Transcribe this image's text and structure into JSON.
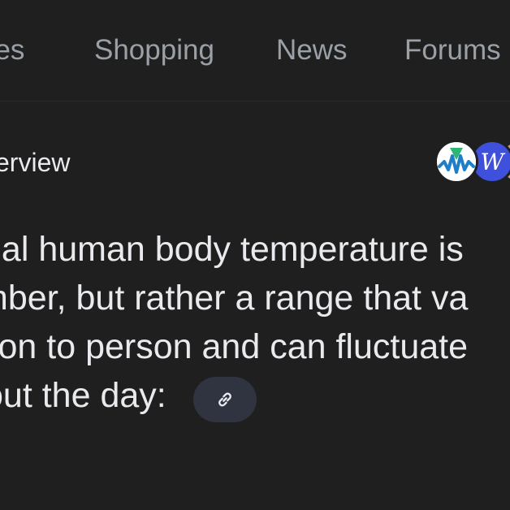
{
  "nav": {
    "tabs": [
      {
        "label": "ges"
      },
      {
        "label": "Shopping"
      },
      {
        "label": "News"
      },
      {
        "label": "Forums"
      }
    ]
  },
  "overview": {
    "title": "erview",
    "sources": [
      {
        "icon": "m-logo-icon"
      },
      {
        "icon": "w-logo-icon"
      },
      {
        "icon": "third-source-icon"
      }
    ]
  },
  "content": {
    "lines": [
      "nal human body temperature is",
      "mber, but rather a range that va",
      "son to person and can fluctuate",
      "out the day:"
    ],
    "link_icon": "link-icon"
  },
  "colors": {
    "background": "#1f1f1f",
    "text": "#e8eaed",
    "muted": "#9aa0a6",
    "chip": "#303340",
    "w_avatar": "#3e50dc"
  }
}
